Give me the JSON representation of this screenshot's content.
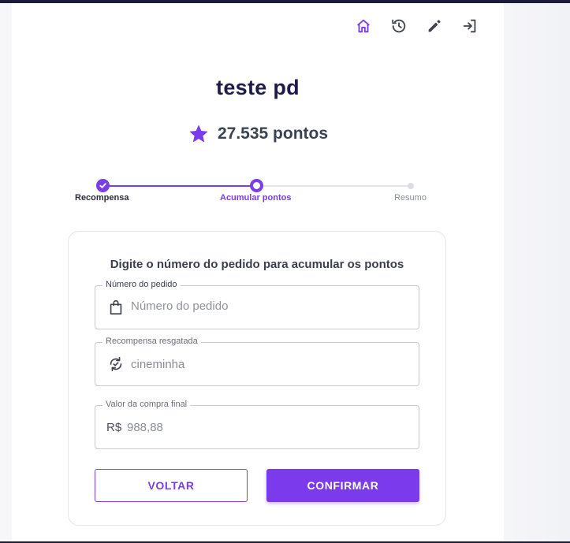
{
  "header": {
    "icons": [
      "home-icon",
      "history-icon",
      "edit-icon",
      "logout-icon"
    ]
  },
  "profile": {
    "name": "teste pd",
    "points": "27.535 pontos"
  },
  "stepper": {
    "steps": [
      {
        "label": "Recompensa",
        "status": "done"
      },
      {
        "label": "Acumular pontos",
        "status": "active"
      },
      {
        "label": "Resumo",
        "status": "pending"
      }
    ]
  },
  "form": {
    "title": "Digite o número do pedido para acumular os pontos",
    "order_number": {
      "label": "Número do pedido",
      "placeholder": "Número do pedido",
      "value": ""
    },
    "reward": {
      "label": "Recompensa resgatada",
      "value": "cineminha"
    },
    "purchase_value": {
      "label": "Valor da compra final",
      "prefix": "R$",
      "value": "988,88"
    },
    "back_label": "VOLTAR",
    "confirm_label": "CONFIRMAR"
  },
  "colors": {
    "accent": "#7c3aed",
    "title": "#1e1b4b",
    "topbar": "#1d1b3a"
  }
}
